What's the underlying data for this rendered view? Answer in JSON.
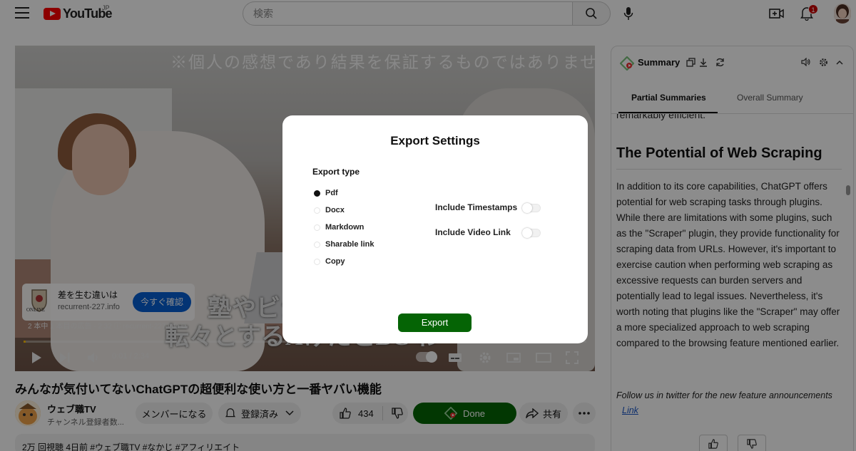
{
  "header": {
    "logo_text": "YouTube",
    "region": "JP",
    "search_placeholder": "検索",
    "notification_count": "1"
  },
  "video": {
    "banner_text": "※個人の感想であり結果を保証するものではありません",
    "caption_line1": "塾やビジ",
    "caption_line2": "転々とするAけたとBC わ",
    "ad": {
      "title": "差を生む違いは",
      "domain": "recurrent-227.info",
      "button": "今すぐ確認",
      "logo_label": "ONLINE",
      "info": "2 本中 1 本目の広告 · 2:32  ⓘ   recurrent-227.info  ⧉"
    },
    "time": "0:01 / 2:34",
    "progress_percent": 0.4
  },
  "below_video": {
    "title": "みんなが気付いてないChatGPTの超便利な使い方と一番ヤバい機能",
    "channel_name": "ウェブ職TV",
    "channel_subs": "チャンネル登録者数...",
    "member_button": "メンバーになる",
    "subscribed_button": "登録済み",
    "like_count": "434",
    "done_button": "Done",
    "share_button": "共有",
    "description": "2万 回視聴  4日前  #ウェブ職TV #なかじ #アフィリエイト"
  },
  "modal": {
    "title": "Export Settings",
    "export_type_label": "Export type",
    "options": [
      "Pdf",
      "Docx",
      "Markdown",
      "Sharable link",
      "Copy"
    ],
    "selected_option": "Pdf",
    "include_timestamps_label": "Include Timestamps",
    "include_video_link_label": "Include Video Link",
    "include_timestamps": false,
    "include_video_link": false,
    "export_button": "Export"
  },
  "panel": {
    "title": "Summary",
    "tabs": [
      "Partial Summaries",
      "Overall Summary"
    ],
    "active_tab": "Partial Summaries",
    "cut_text": "remarkably efficient.",
    "heading": "The Potential of Web Scraping",
    "paragraph": "In addition to its core capabilities, ChatGPT offers potential for web scraping tasks through plugins. While there are limitations with some plugins, such as the \"Scraper\" plugin, they provide functionality for scraping data from URLs. However, it's important to exercise caution when performing web scraping as excessive requests can burden servers and potentially lead to legal issues. Nevertheless, it's worth noting that plugins like the \"Scraper\" may offer a more specialized approach to web scraping compared to the browsing feature mentioned earlier.",
    "follow_text": "Follow us in twitter for the new feature announcements",
    "link_text": "Link"
  },
  "colors": {
    "youtube_red": "#ff0000",
    "export_green": "#056405",
    "ad_blue": "#065fd4"
  }
}
